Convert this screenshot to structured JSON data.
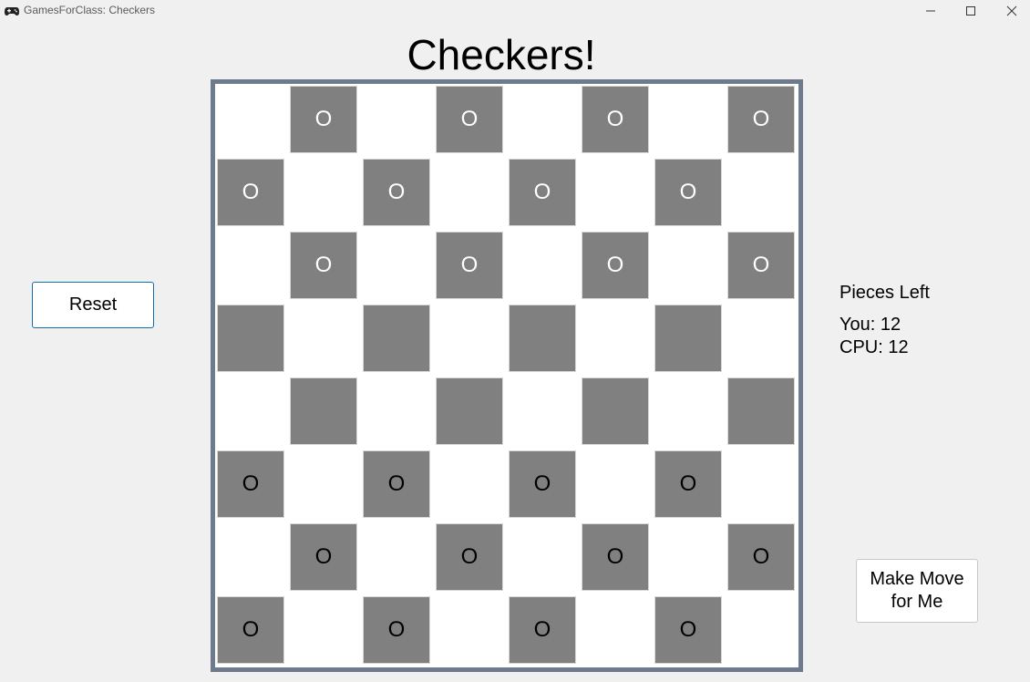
{
  "window": {
    "title": "GamesForClass: Checkers",
    "icons": {
      "app": "gamepad-icon",
      "minimize": "minimize-icon",
      "maximize": "maximize-icon",
      "close": "close-icon"
    }
  },
  "header": {
    "title": "Checkers!"
  },
  "controls": {
    "reset_label": "Reset",
    "make_move_label": "Make Move for Me"
  },
  "score": {
    "heading": "Pieces Left",
    "you": "You: 12",
    "cpu": "CPU: 12"
  },
  "board": {
    "size": 8,
    "colors": {
      "dark_square": "#808080",
      "light_square": "#ffffff",
      "frame": "#6d7b8c",
      "cpu_piece": "#ffffff",
      "you_piece": "#000000"
    },
    "rows": [
      [
        "",
        "cpu",
        "",
        "cpu",
        "",
        "cpu",
        "",
        "cpu"
      ],
      [
        "cpu",
        "",
        "cpu",
        "",
        "cpu",
        "",
        "cpu",
        ""
      ],
      [
        "",
        "cpu",
        "",
        "cpu",
        "",
        "cpu",
        "",
        "cpu"
      ],
      [
        "empty",
        "",
        "empty",
        "",
        "empty",
        "",
        "empty",
        ""
      ],
      [
        "",
        "empty",
        "",
        "empty",
        "",
        "empty",
        "",
        "empty"
      ],
      [
        "you",
        "",
        "you",
        "",
        "you",
        "",
        "you",
        ""
      ],
      [
        "",
        "you",
        "",
        "you",
        "",
        "you",
        "",
        "you"
      ],
      [
        "you",
        "",
        "you",
        "",
        "you",
        "",
        "you",
        ""
      ]
    ],
    "piece_symbol": "O"
  }
}
